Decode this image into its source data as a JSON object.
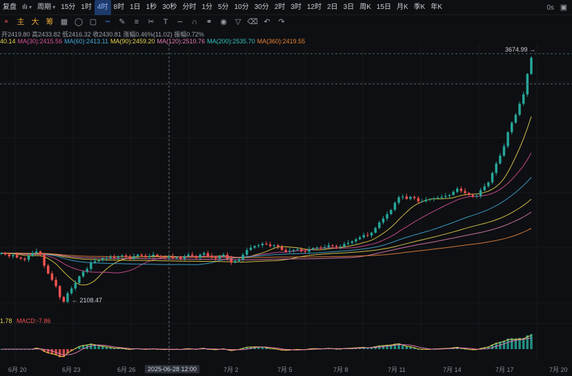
{
  "topbar": {
    "items": [
      {
        "key": "fuqi",
        "label": "复盘",
        "active": false,
        "menu": false
      },
      {
        "key": "chart",
        "label": "ılı",
        "active": false,
        "menu": true
      },
      {
        "key": "period",
        "label": "周期",
        "active": false,
        "menu": true
      },
      {
        "key": "m15",
        "label": "15分",
        "active": false,
        "menu": false
      },
      {
        "key": "h1",
        "label": "1时",
        "active": false,
        "menu": false
      },
      {
        "key": "h4",
        "label": "4时",
        "active": true,
        "menu": false
      },
      {
        "key": "h8",
        "label": "8时",
        "active": false,
        "menu": false
      },
      {
        "key": "d1",
        "label": "1日",
        "active": false,
        "menu": false
      },
      {
        "key": "s1",
        "label": "1秒",
        "active": false,
        "menu": false
      },
      {
        "key": "s30",
        "label": "30秒",
        "active": false,
        "menu": false
      },
      {
        "key": "fs",
        "label": "分时",
        "active": false,
        "menu": false
      },
      {
        "key": "m1",
        "label": "1分",
        "active": false,
        "menu": false
      },
      {
        "key": "m5",
        "label": "5分",
        "active": false,
        "menu": false
      },
      {
        "key": "m10",
        "label": "10分",
        "active": false,
        "menu": false
      },
      {
        "key": "m30",
        "label": "30分",
        "active": false,
        "menu": false
      },
      {
        "key": "h2",
        "label": "2时",
        "active": false,
        "menu": false
      },
      {
        "key": "h3",
        "label": "3时",
        "active": false,
        "menu": false
      },
      {
        "key": "h12",
        "label": "12时",
        "active": false,
        "menu": false
      },
      {
        "key": "d2",
        "label": "2日",
        "active": false,
        "menu": false
      },
      {
        "key": "d3",
        "label": "3日",
        "active": false,
        "menu": false
      },
      {
        "key": "wk",
        "label": "周K",
        "active": false,
        "menu": false
      },
      {
        "key": "d15",
        "label": "15日",
        "active": false,
        "menu": false
      },
      {
        "key": "mk",
        "label": "月K",
        "active": false,
        "menu": false
      },
      {
        "key": "qk",
        "label": "季K",
        "active": false,
        "menu": false
      },
      {
        "key": "yk",
        "label": "年K",
        "active": false,
        "menu": false
      }
    ],
    "right_label": "0s"
  },
  "toolbar2": {
    "tabs": [
      "主",
      "大",
      "筹"
    ]
  },
  "ohlc": {
    "open_label": "开",
    "open": "2419.80",
    "high_label": "高",
    "high": "2433.82",
    "low_label": "低",
    "low": "2416.32",
    "close_label": "收",
    "close": "2430.81",
    "change_label": "涨幅",
    "change": "0.46%(11.02)",
    "amp_label": "振幅",
    "amp": "0.72%"
  },
  "ma_legend": [
    {
      "text": "40.14",
      "color": "#e8d44d"
    },
    {
      "text": "MA(30):2415.56",
      "color": "#d9509a"
    },
    {
      "text": "MA(60):2413.11",
      "color": "#3fa7d6"
    },
    {
      "text": "MA(90):2459.20",
      "color": "#e8d44d"
    },
    {
      "text": "MA(120):2510.76",
      "color": "#e07ab0"
    },
    {
      "text": "MA(200):2535.70",
      "color": "#36c2c2"
    },
    {
      "text": "MA(360):2419.55",
      "color": "#e8843a"
    }
  ],
  "macd_label": {
    "value": "1.78",
    "macd": "MACD:-7.86"
  },
  "colors": {
    "up": "#26a69a",
    "down": "#ef5350",
    "bg": "#0e0f12"
  },
  "chart_data": {
    "type": "candlestick",
    "price_labels": {
      "high": "3674.99",
      "low": "2108.47"
    },
    "x_ticks": [
      "6月 20",
      "6月 23",
      "6月 26",
      "7月 2",
      "7月 5",
      "7月 8",
      "7月 11",
      "7月 14",
      "7月 17",
      "7月 20"
    ],
    "crosshair_label": "2025-06-28 12:00",
    "close": [
      2430,
      2422,
      2410,
      2418,
      2402,
      2395,
      2388,
      2412,
      2430,
      2440,
      2420,
      2350,
      2300,
      2260,
      2220,
      2150,
      2120,
      2175,
      2205,
      2240,
      2282,
      2312,
      2330,
      2368,
      2378,
      2385,
      2395,
      2398,
      2405,
      2400,
      2410,
      2415,
      2405,
      2395,
      2410,
      2420,
      2414,
      2405,
      2412,
      2420,
      2410,
      2405,
      2400,
      2410,
      2398,
      2405,
      2395,
      2410,
      2420,
      2412,
      2400,
      2420,
      2430,
      2412,
      2405,
      2395,
      2410,
      2420,
      2395,
      2370,
      2380,
      2390,
      2420,
      2450,
      2465,
      2475,
      2480,
      2490,
      2485,
      2475,
      2480,
      2470,
      2450,
      2440,
      2445,
      2450,
      2455,
      2442,
      2440,
      2455,
      2462,
      2465,
      2462,
      2468,
      2480,
      2475,
      2468,
      2472,
      2488,
      2495,
      2505,
      2518,
      2530,
      2545,
      2542,
      2560,
      2590,
      2625,
      2650,
      2678,
      2705,
      2750,
      2785,
      2790,
      2775,
      2788,
      2780,
      2760,
      2760,
      2770,
      2774,
      2778,
      2782,
      2788,
      2794,
      2800,
      2820,
      2840,
      2825,
      2812,
      2800,
      2790,
      2795,
      2830,
      2855,
      2880,
      2940,
      3000,
      3050,
      3110,
      3200,
      3260,
      3310,
      3380,
      3440,
      3570,
      3674
    ],
    "ma_series": [
      {
        "name": "MA(30)",
        "color": "#d9509a"
      },
      {
        "name": "MA(60)",
        "color": "#3fa7d6"
      },
      {
        "name": "MA(90)",
        "color": "#e8d44d"
      },
      {
        "name": "MA(120)",
        "color": "#e07ab0"
      },
      {
        "name": "MA(200)",
        "color": "#36c2c2"
      },
      {
        "name": "MA(360)",
        "color": "#e8843a"
      }
    ],
    "ylim": [
      2060,
      3760
    ]
  }
}
